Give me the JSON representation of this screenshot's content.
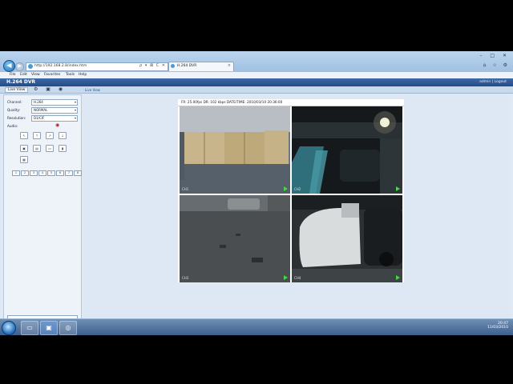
{
  "browser": {
    "address": "http://192.168.2.8/index.htm",
    "address_tools": "ρ ▾ ⊠ C ✕",
    "tab_title": "H.264 DVR",
    "tab_close": "×",
    "window_controls": "– □ ✕",
    "right_tools": "⌂ ☆ ⚙",
    "back_symbol": "◀",
    "forward_symbol": "▶",
    "menu": [
      "File",
      "Edit",
      "View",
      "Favorites",
      "Tools",
      "Help"
    ]
  },
  "dvr": {
    "title": "H.264 DVR",
    "user_area": "admin | Logout",
    "live_view_tab": "Live View",
    "subheader_icons": "⚙ ▣ ◉",
    "live_view_label": "Live View",
    "fields": {
      "channel_label": "Channel:",
      "channel_value": "H.264",
      "quality_label": "Quality:",
      "quality_value": "NORMAL",
      "resolution_label": "Resolution:",
      "resolution_value": "D1/CIF",
      "audio_label": "Audio:"
    },
    "status_text": "FR: 25.00fps  DR: 102 kbps  DATE/TIME: 2010/03/10 20:36:00",
    "cameras": [
      {
        "label": "CH1"
      },
      {
        "label": "CH2"
      },
      {
        "label": "CH3"
      },
      {
        "label": "CH4"
      }
    ]
  },
  "taskbar": {
    "tray_time": "20:47",
    "tray_date": "11/03/2010"
  },
  "colors": {
    "header_blue": "#234a86",
    "rec_green": "#3fdc3f",
    "page_bg": "#dfe9f4"
  }
}
